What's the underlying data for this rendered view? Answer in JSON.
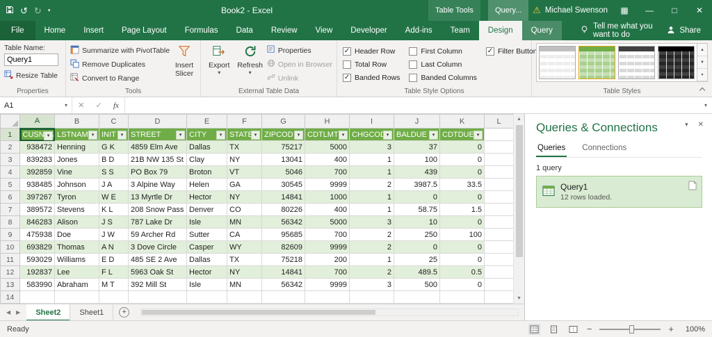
{
  "colors": {
    "excel_green": "#217346",
    "table_header_green": "#70AD47",
    "banded_row_green": "#E2EFDA",
    "query_selected_bg": "#D9EBD2",
    "ribbon_bg": "#F3F2F1"
  },
  "icons": {
    "check": "✓",
    "dropdown_small": "▾",
    "undo": "↺",
    "redo": "↻",
    "warning": "⚠",
    "minimize": "—",
    "maximize": "□",
    "close": "✕",
    "ribbon_display": "▦",
    "filter_arrow": "▾",
    "name_box_arrow": "▾",
    "cancel": "✕",
    "enter": "✓",
    "nav_left": "◀",
    "nav_right": "▶",
    "scroll_up": "▲",
    "scroll_down": "▼",
    "zoom_out": "−",
    "zoom_in": "+"
  },
  "titlebar": {
    "title": "Book2 - Excel",
    "contextual_groups": [
      "Table Tools",
      "Query..."
    ],
    "user_name": "Michael Swenson"
  },
  "ribbon": {
    "tabs": [
      {
        "label": "File",
        "type": "file"
      },
      {
        "label": "Home",
        "type": "normal"
      },
      {
        "label": "Insert",
        "type": "normal"
      },
      {
        "label": "Page Layout",
        "type": "normal"
      },
      {
        "label": "Formulas",
        "type": "normal"
      },
      {
        "label": "Data",
        "type": "normal"
      },
      {
        "label": "Review",
        "type": "normal"
      },
      {
        "label": "View",
        "type": "normal"
      },
      {
        "label": "Developer",
        "type": "normal"
      },
      {
        "label": "Add-ins",
        "type": "normal"
      },
      {
        "label": "Team",
        "type": "normal"
      },
      {
        "label": "Design",
        "type": "active"
      },
      {
        "label": "Query",
        "type": "contextual"
      }
    ],
    "tell_me": "Tell me what you want to do",
    "share": "Share"
  },
  "ribbon_groups": {
    "properties": {
      "group_label": "Properties",
      "table_name_label": "Table Name:",
      "table_name_value": "Query1",
      "resize_table_label": "Resize Table"
    },
    "tools": {
      "group_label": "Tools",
      "summarize_label": "Summarize with PivotTable",
      "remove_duplicates_label": "Remove Duplicates",
      "convert_label": "Convert to Range",
      "insert_slicer_label": "Insert Slicer"
    },
    "external": {
      "group_label": "External Table Data",
      "export_label": "Export",
      "refresh_label": "Refresh",
      "properties_label": "Properties",
      "open_browser_label": "Open in Browser",
      "unlink_label": "Unlink"
    },
    "style_options": {
      "group_label": "Table Style Options",
      "checkboxes": [
        {
          "label": "Header Row",
          "checked": true
        },
        {
          "label": "Total Row",
          "checked": false
        },
        {
          "label": "Banded Rows",
          "checked": true
        },
        {
          "label": "First Column",
          "checked": false
        },
        {
          "label": "Last Column",
          "checked": false
        },
        {
          "label": "Banded Columns",
          "checked": false
        },
        {
          "label": "Filter Button",
          "checked": true
        }
      ]
    },
    "table_styles": {
      "group_label": "Table Styles"
    }
  },
  "formula_bar": {
    "name_box": "A1",
    "fx_label": "fx",
    "formula_value": ""
  },
  "worksheet": {
    "selected_cell": "A1",
    "columns": [
      "A",
      "B",
      "C",
      "D",
      "E",
      "F",
      "G",
      "H",
      "I",
      "J",
      "K",
      "L"
    ],
    "row_count": 14,
    "table": {
      "headers": [
        "CUSNUM",
        "LSTNAM",
        "INIT",
        "STREET",
        "CITY",
        "STATE",
        "ZIPCOD",
        "CDTLMT",
        "CHGCOD",
        "BALDUE",
        "CDTDUE"
      ],
      "rows": [
        [
          "938472",
          "Henning",
          "G K",
          "4859 Elm Ave",
          "Dallas",
          "TX",
          "75217",
          "5000",
          "3",
          "37",
          "0"
        ],
        [
          "839283",
          "Jones",
          "B D",
          "21B NW 135 St",
          "Clay",
          "NY",
          "13041",
          "400",
          "1",
          "100",
          "0"
        ],
        [
          "392859",
          "Vine",
          "S S",
          "PO Box 79",
          "Broton",
          "VT",
          "5046",
          "700",
          "1",
          "439",
          "0"
        ],
        [
          "938485",
          "Johnson",
          "J A",
          "3 Alpine Way",
          "Helen",
          "GA",
          "30545",
          "9999",
          "2",
          "3987.5",
          "33.5"
        ],
        [
          "397267",
          "Tyron",
          "W E",
          "13 Myrtle Dr",
          "Hector",
          "NY",
          "14841",
          "1000",
          "1",
          "0",
          "0"
        ],
        [
          "389572",
          "Stevens",
          "K L",
          "208 Snow Pass",
          "Denver",
          "CO",
          "80226",
          "400",
          "1",
          "58.75",
          "1.5"
        ],
        [
          "846283",
          "Alison",
          "J S",
          "787 Lake Dr",
          "Isle",
          "MN",
          "56342",
          "5000",
          "3",
          "10",
          "0"
        ],
        [
          "475938",
          "Doe",
          "J W",
          "59 Archer Rd",
          "Sutter",
          "CA",
          "95685",
          "700",
          "2",
          "250",
          "100"
        ],
        [
          "693829",
          "Thomas",
          "A N",
          "3 Dove Circle",
          "Casper",
          "WY",
          "82609",
          "9999",
          "2",
          "0",
          "0"
        ],
        [
          "593029",
          "Williams",
          "E D",
          "485 SE 2 Ave",
          "Dallas",
          "TX",
          "75218",
          "200",
          "1",
          "25",
          "0"
        ],
        [
          "192837",
          "Lee",
          "F L",
          "5963 Oak St",
          "Hector",
          "NY",
          "14841",
          "700",
          "2",
          "489.5",
          "0.5"
        ],
        [
          "583990",
          "Abraham",
          "M T",
          "392 Mill St",
          "Isle",
          "MN",
          "56342",
          "9999",
          "3",
          "500",
          "0"
        ]
      ]
    }
  },
  "queries_pane": {
    "title": "Queries & Connections",
    "tabs": [
      {
        "label": "Queries",
        "active": true
      },
      {
        "label": "Connections",
        "active": false
      }
    ],
    "count_label": "1 query",
    "queries": [
      {
        "name": "Query1",
        "detail": "12 rows loaded."
      }
    ]
  },
  "sheet_bar": {
    "tabs": [
      {
        "label": "Sheet2",
        "active": true
      },
      {
        "label": "Sheet1",
        "active": false
      }
    ],
    "add_button": "+"
  },
  "status_bar": {
    "ready_label": "Ready",
    "zoom_label": "100%"
  }
}
